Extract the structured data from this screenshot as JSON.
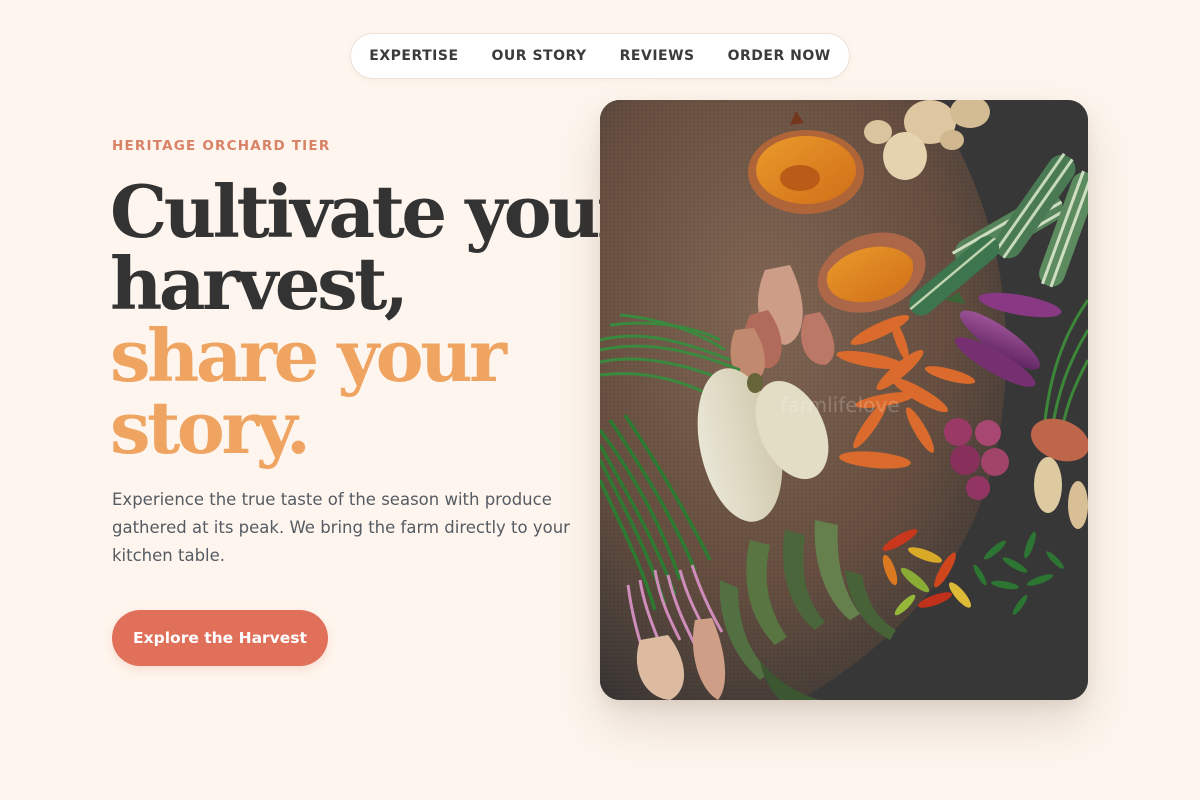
{
  "nav": {
    "items": [
      {
        "label": "EXPERTISE"
      },
      {
        "label": "OUR STORY"
      },
      {
        "label": "REVIEWS"
      },
      {
        "label": "ORDER NOW"
      }
    ]
  },
  "hero": {
    "eyebrow": "HERITAGE ORCHARD TIER",
    "headline": {
      "line1": "Cultivate your",
      "line2": "harvest,",
      "line3": "share your",
      "line4": "story."
    },
    "description": "Experience the true taste of the season with produce gathered at its peak. We bring the farm directly to your kitchen table.",
    "cta_label": "Explore the Harvest"
  },
  "photo": {
    "watermark": "farmlifelove"
  },
  "colors": {
    "background": "#fef6ee",
    "heading": "#333333",
    "accent_orange": "#efa461",
    "eyebrow": "#d98266",
    "button": "#e0705a",
    "body_text": "#555b63"
  }
}
